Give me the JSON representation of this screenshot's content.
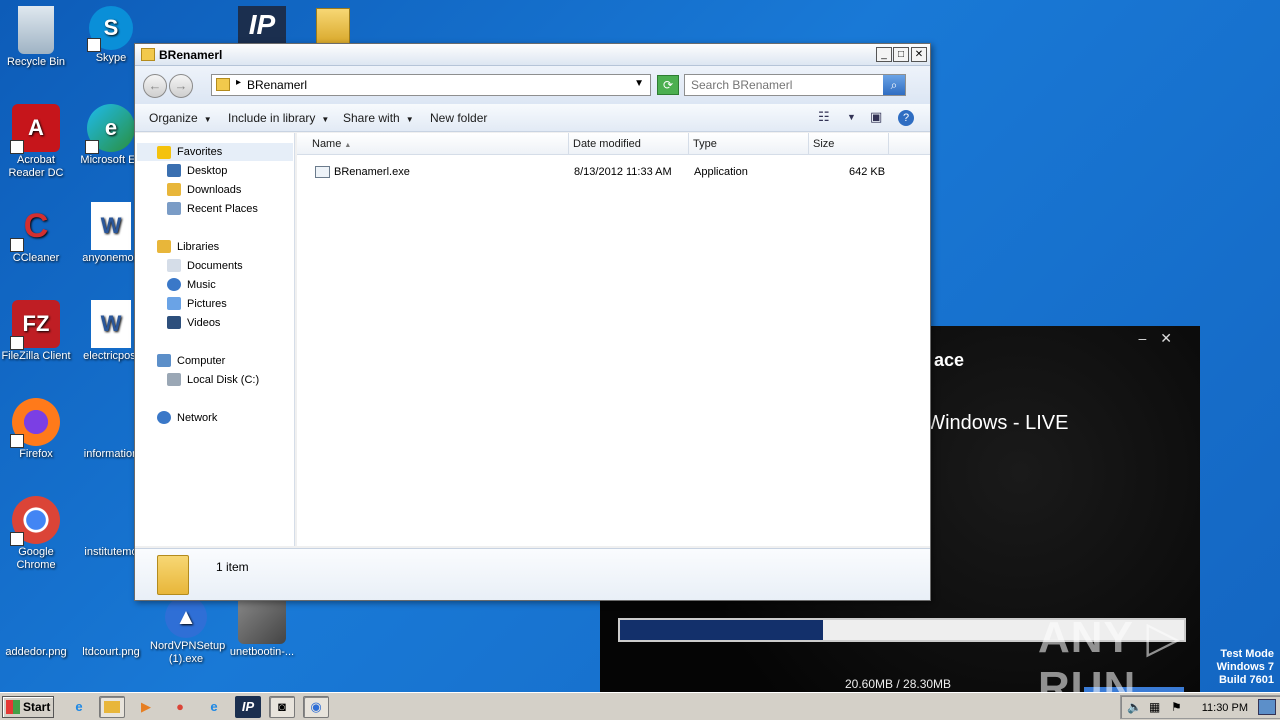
{
  "desktop": {
    "icons": [
      {
        "label": "Recycle Bin"
      },
      {
        "label": "Skype"
      },
      {
        "label": "Acrobat Reader DC"
      },
      {
        "label": "Microsoft Ed"
      },
      {
        "label": "CCleaner"
      },
      {
        "label": "anyonemod"
      },
      {
        "label": "FileZilla Client"
      },
      {
        "label": "electricpost"
      },
      {
        "label": "Firefox"
      },
      {
        "label": "information"
      },
      {
        "label": "Google Chrome"
      },
      {
        "label": "institutemo"
      },
      {
        "label": "addedor.png"
      },
      {
        "label": "ltdcourt.png"
      },
      {
        "label": "NordVPNSetup (1).exe"
      },
      {
        "label": "unetbootin-..."
      }
    ]
  },
  "bg_app": {
    "title_fragment": "ace",
    "subtitle_fragment": "r Windows - LIVE",
    "line_fragment": "...)",
    "progress_fraction": 0.36,
    "size_text": "20.60MB / 28.30MB"
  },
  "watermark": "ANY RUN",
  "test_mode": {
    "line1": "Test Mode",
    "line2": "Windows 7",
    "line3": "Build 7601"
  },
  "explorer": {
    "title": "BRenamerl",
    "address": {
      "path": "BRenamerl"
    },
    "search": {
      "placeholder": "Search BRenamerl"
    },
    "toolbar": {
      "organize": "Organize",
      "include_in_library": "Include in library",
      "share_with": "Share with",
      "new_folder": "New folder"
    },
    "nav": {
      "favorites": "Favorites",
      "desktop": "Desktop",
      "downloads": "Downloads",
      "recent_places": "Recent Places",
      "libraries": "Libraries",
      "documents": "Documents",
      "music": "Music",
      "pictures": "Pictures",
      "videos": "Videos",
      "computer": "Computer",
      "local_disk": "Local Disk (C:)",
      "network": "Network"
    },
    "columns": {
      "name": "Name",
      "date_modified": "Date modified",
      "type": "Type",
      "size": "Size"
    },
    "files": [
      {
        "name": "BRenamerl.exe",
        "date_modified": "8/13/2012 11:33 AM",
        "type": "Application",
        "size": "642 KB"
      }
    ],
    "status": {
      "count": "1 item"
    }
  },
  "taskbar": {
    "start_label": "Start",
    "clock": "11:30 PM"
  }
}
